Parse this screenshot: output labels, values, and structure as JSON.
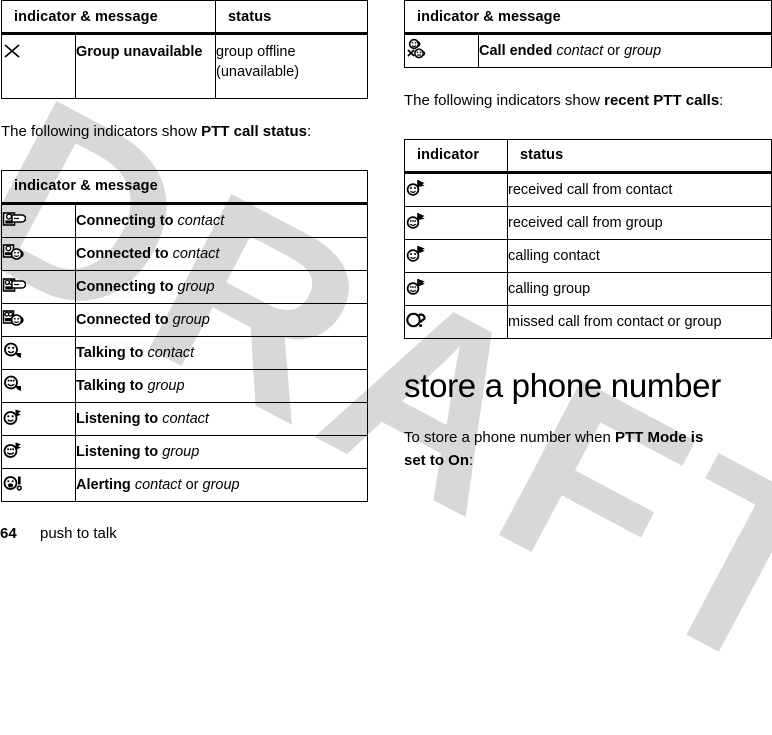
{
  "document": {
    "page_number": "64",
    "section_name": "push to talk",
    "watermark": "DRAFT",
    "watermark_color": "#d8d8d8"
  },
  "table_group_unavailable": {
    "headers": [
      "indicator & message",
      "status"
    ],
    "rows": [
      {
        "icon": "x-cross-icon",
        "message_bold": "Group unavailable",
        "message_var": "",
        "status_line1": "group offline",
        "status_line2": "(unavailable)"
      }
    ]
  },
  "intro_ptt_call_status": {
    "prefix": "The following indicators show ",
    "bold": "PTT call status",
    "suffix": ":"
  },
  "table_ptt_call_status": {
    "headers": [
      "indicator & message"
    ],
    "rows": [
      {
        "icon": "connecting-contact-icon",
        "bold": "Connecting to",
        "var": "contact",
        "tail": ""
      },
      {
        "icon": "connected-contact-icon",
        "bold": "Connected to",
        "var": "contact",
        "tail": ""
      },
      {
        "icon": "connecting-group-icon",
        "bold": "Connecting to",
        "var": "group",
        "tail": ""
      },
      {
        "icon": "connected-group-icon",
        "bold": "Connected to",
        "var": "group",
        "tail": ""
      },
      {
        "icon": "talking-contact-icon",
        "bold": "Talking to",
        "var": "contact",
        "tail": ""
      },
      {
        "icon": "talking-group-icon",
        "bold": "Talking to",
        "var": "group",
        "tail": ""
      },
      {
        "icon": "listening-contact-icon",
        "bold": "Listening to",
        "var": "contact",
        "tail": ""
      },
      {
        "icon": "listening-group-icon",
        "bold": "Listening to",
        "var": "group",
        "tail": ""
      },
      {
        "icon": "alerting-icon",
        "bold": "Alerting",
        "var": "contact",
        "tail": " or ",
        "var2": "group"
      }
    ]
  },
  "table_call_ended": {
    "headers": [
      "indicator & message"
    ],
    "rows": [
      {
        "icon": "call-ended-icon",
        "bold": "Call ended",
        "var": "contact",
        "tail": " or ",
        "var2": "group"
      }
    ]
  },
  "intro_recent_calls": {
    "prefix": "The following indicators show ",
    "bold": "recent PTT calls",
    "suffix": ":"
  },
  "table_recent_calls": {
    "headers": [
      "indicator",
      "status"
    ],
    "rows": [
      {
        "icon": "received-call-contact-icon",
        "status": "received call from contact"
      },
      {
        "icon": "received-call-group-icon",
        "status": "received call from group"
      },
      {
        "icon": "calling-contact-icon",
        "status": "calling contact"
      },
      {
        "icon": "calling-group-icon",
        "status": "calling group"
      },
      {
        "icon": "missed-call-icon",
        "status": "missed call from contact or group"
      }
    ]
  },
  "section": {
    "heading": "store a phone number",
    "paragraph_prefix": "To store a phone number when ",
    "paragraph_bold": "PTT Mode is set to On",
    "paragraph_suffix": ":"
  }
}
